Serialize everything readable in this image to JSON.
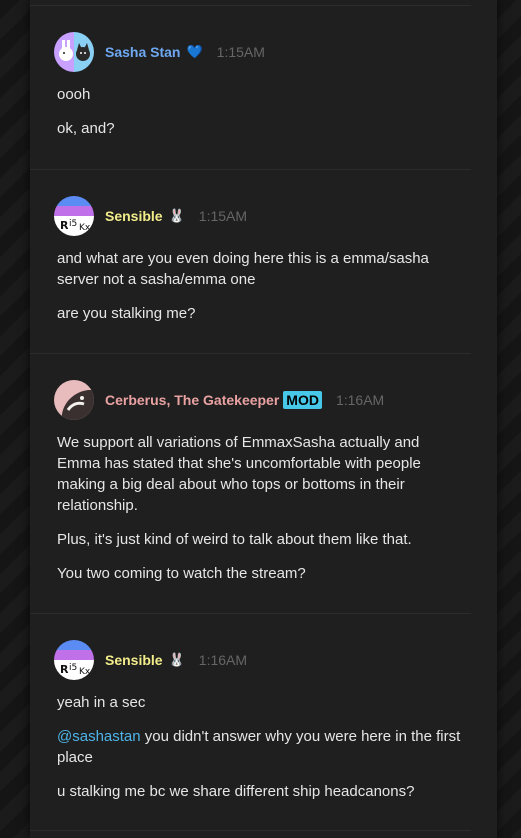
{
  "messages": [
    {
      "author": "Sasha Stan",
      "author_color": "#6ea8f2",
      "badge": "💙",
      "time": "1:15AM",
      "lines": [
        "oooh",
        "ok, and?"
      ]
    },
    {
      "author": "Sensible",
      "author_color": "#f2ec8a",
      "badge": "🐰",
      "time": "1:15AM",
      "lines": [
        "and what are you even doing here this is a emma/sasha server not a sasha/emma one",
        "are you stalking me?"
      ]
    },
    {
      "author": "Cerberus, The Gatekeeper",
      "author_color": "#e9a1a1",
      "role": "MOD",
      "time": "1:16AM",
      "lines": [
        "We support all variations of EmmaxSasha actually and Emma has stated that she's uncomfortable with people making a big deal about who tops or bottoms in their relationship.",
        "Plus, it's just kind of weird to talk about them like that.",
        "You two coming to watch the stream?"
      ]
    },
    {
      "author": "Sensible",
      "author_color": "#f2ec8a",
      "badge": "🐰",
      "time": "1:16AM",
      "line1": "yeah in a sec",
      "mention": "@sashastan",
      "line2_rest": " you didn't answer why you were here in the first place",
      "line3": "u stalking me bc we share different ship headcanons?"
    }
  ]
}
